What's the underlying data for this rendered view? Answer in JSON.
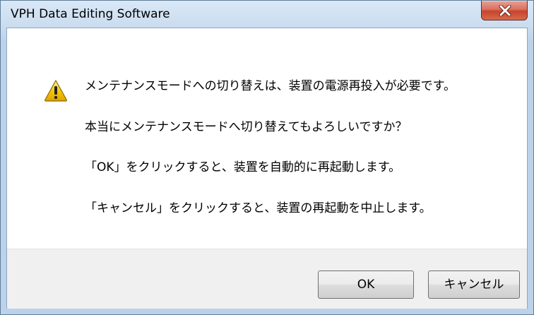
{
  "window": {
    "title": "VPH Data Editing Software"
  },
  "dialog": {
    "icon": "warning-icon",
    "messages": [
      "メンテナンスモードへの切り替えは、装置の電源再投入が必要です。",
      "本当にメンテナンスモードへ切り替えてもよろしいですか？",
      "「OK」をクリックすると、装置を自動的に再起動します。",
      "「キャンセル」をクリックすると、装置の再起動を中止します。"
    ]
  },
  "buttons": {
    "ok_label": "OK",
    "cancel_label": "キャンセル"
  },
  "colors": {
    "close_button": "#c7442d",
    "warning_fill": "#f5c400"
  }
}
